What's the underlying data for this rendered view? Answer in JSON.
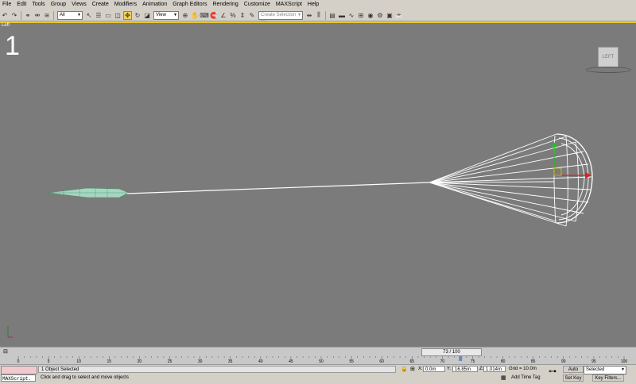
{
  "menu": [
    "File",
    "Edit",
    "Tools",
    "Group",
    "Views",
    "Create",
    "Modifiers",
    "Animation",
    "Graph Editors",
    "Rendering",
    "Customize",
    "MAXScript",
    "Help"
  ],
  "toolbar": {
    "selection_filter": "All",
    "reference_coord": "View",
    "named_selection_placeholder": "Create Selection Se"
  },
  "viewport": {
    "label": "Left",
    "number": "1",
    "viewcube_label": "LEFT",
    "background": "#7b7b7b",
    "active_border": "#e7c832"
  },
  "trackbar": {
    "frame_counter": "73 / 100",
    "current_frame": 73,
    "total_frames": 100,
    "ticks": [
      "0",
      "5",
      "10",
      "15",
      "20",
      "25",
      "30",
      "35",
      "40",
      "45",
      "50",
      "55",
      "60",
      "65",
      "70",
      "75",
      "80",
      "85",
      "90",
      "95",
      "100"
    ]
  },
  "status": {
    "maxscript_label": "MAXScript.",
    "selection_info": "1 Object Selected",
    "prompt": "Click and drag to select and move objects",
    "x_label": "X:",
    "x_value": "0.0m",
    "y_label": "Y:",
    "y_value": "16.85m",
    "z_label": "Z:",
    "z_value": "1.014m",
    "grid": "Grid = 10.0m",
    "add_time_tag": "Add Time Tag",
    "auto_key": "Auto Key",
    "set_key": "Set Key",
    "key_mode": "Selected",
    "key_filters": "Key Filters..."
  },
  "icons": [
    "undo-icon",
    "redo-icon",
    "link-icon",
    "unlink-icon",
    "bind-spacewarp-icon",
    "select-object-icon",
    "select-by-name-icon",
    "rect-region-icon",
    "window-crossing-icon",
    "move-icon",
    "rotate-icon",
    "scale-icon",
    "pivot-icon",
    "manipulate-icon",
    "snap-icon",
    "angle-snap-icon",
    "percent-snap-icon",
    "spinner-snap-icon",
    "mirror-icon",
    "align-icon",
    "layer-manager-icon",
    "curve-editor-icon",
    "schematic-icon",
    "material-editor-icon",
    "render-setup-icon",
    "render-frame-icon",
    "render-icon",
    "key-icon"
  ]
}
